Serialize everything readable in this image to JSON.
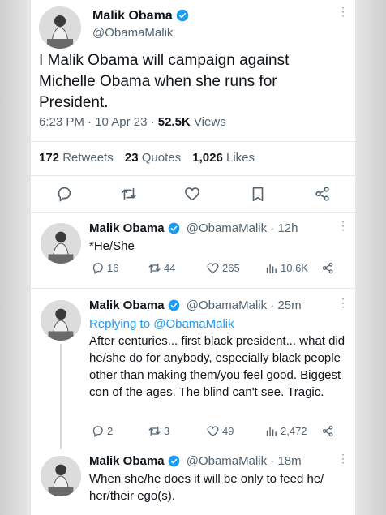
{
  "main_tweet": {
    "name": "Malik Obama",
    "handle": "@ObamaMalik",
    "text": "I Malik Obama will campaign against Michelle Obama when she runs for President.",
    "time": "6:23 PM · 10 Apr 23 · ",
    "views_count": "52.5K",
    "views_label": " Views",
    "retweets_count": "172",
    "retweets_label": " Retweets",
    "quotes_count": "23",
    "quotes_label": " Quotes",
    "likes_count": "1,026",
    "likes_label": " Likes"
  },
  "replies": [
    {
      "name": "Malik Obama",
      "handle_time": "@ObamaMalik · 12h",
      "replying_to": "",
      "text": "*He/She",
      "reply_count": "16",
      "retweet_count": "44",
      "like_count": "265",
      "view_count": "10.6K"
    },
    {
      "name": "Malik Obama",
      "handle_time": "@ObamaMalik · 25m",
      "replying_to": "Replying to @ObamaMalik",
      "text": "After centuries... first black president... what did he/she do for anybody, especially black people other than making them/you feel good. Biggest con of the ages. The blind can't see. Tragic.",
      "reply_count": "2",
      "retweet_count": "3",
      "like_count": "49",
      "view_count": "2,472"
    },
    {
      "name": "Malik Obama",
      "handle_time": "@ObamaMalik · 18m",
      "replying_to": "",
      "text": "When she/he does it will be only to feed he/ her/their ego(s)."
    }
  ],
  "colors": {
    "verified": "#1d9bf0",
    "link": "#1d9bf0",
    "secondary_text": "#536471"
  },
  "icons": [
    "verified-badge-icon",
    "more-icon",
    "reply-icon",
    "retweet-icon",
    "like-icon",
    "bookmark-icon",
    "share-icon",
    "views-icon"
  ]
}
